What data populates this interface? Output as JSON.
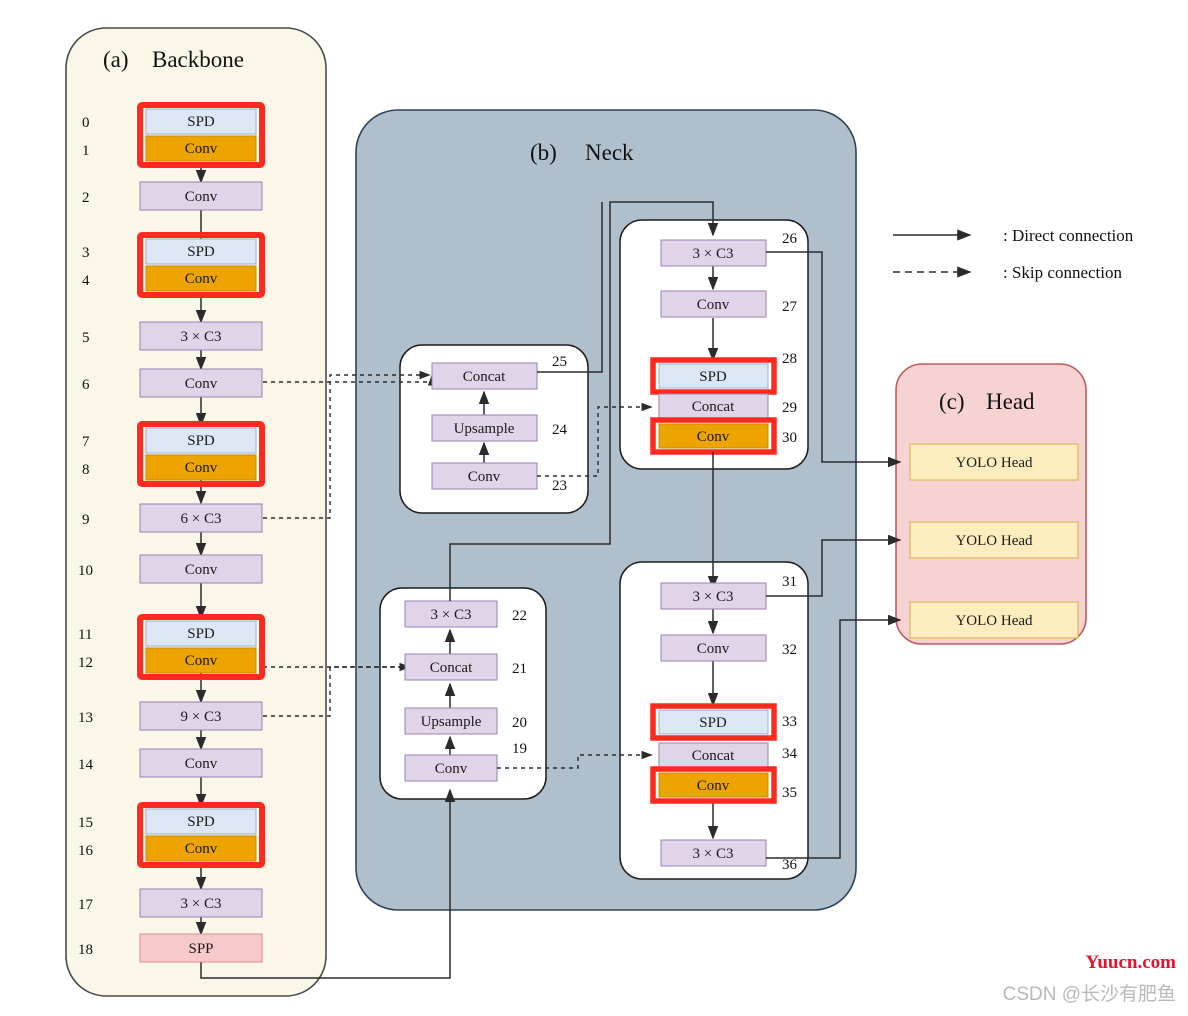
{
  "panels": {
    "backbone": {
      "tag": "(a)",
      "title": "Backbone",
      "fill": "#faf7e8",
      "border": "#4a4a4a"
    },
    "neck": {
      "tag": "(b)",
      "title": "Neck",
      "fill": "#b0bfcc",
      "border": "#2f4356"
    },
    "head": {
      "tag": "(c)",
      "title": "Head",
      "fill": "#f7d2d2",
      "border": "#c05a5a"
    }
  },
  "colors": {
    "spd": "#dce6f5",
    "conv_highlight": "#eda400",
    "conv_normal": "#e0d4e8",
    "spp": "#f6caca",
    "yolo_head": "#fdedbe",
    "highlight_border": "#ff2a1f",
    "block_border": "#9a7fb0",
    "arrow": "#2b2b2b"
  },
  "backbone_nodes": [
    {
      "id": "0",
      "label": "SPD",
      "type": "spd",
      "highlight": true
    },
    {
      "id": "1",
      "label": "Conv",
      "type": "conv_hl",
      "highlight": true
    },
    {
      "id": "2",
      "label": "Conv",
      "type": "conv",
      "highlight": false
    },
    {
      "id": "3",
      "label": "SPD",
      "type": "spd",
      "highlight": true
    },
    {
      "id": "4",
      "label": "Conv",
      "type": "conv_hl",
      "highlight": true
    },
    {
      "id": "5",
      "label": "3 × C3",
      "type": "conv",
      "highlight": false
    },
    {
      "id": "6",
      "label": "Conv",
      "type": "conv",
      "highlight": false
    },
    {
      "id": "7",
      "label": "SPD",
      "type": "spd",
      "highlight": true
    },
    {
      "id": "8",
      "label": "Conv",
      "type": "conv_hl",
      "highlight": true
    },
    {
      "id": "9",
      "label": "6 × C3",
      "type": "conv",
      "highlight": false
    },
    {
      "id": "10",
      "label": "Conv",
      "type": "conv",
      "highlight": false
    },
    {
      "id": "11",
      "label": "SPD",
      "type": "spd",
      "highlight": true
    },
    {
      "id": "12",
      "label": "Conv",
      "type": "conv_hl",
      "highlight": true
    },
    {
      "id": "13",
      "label": "9 × C3",
      "type": "conv",
      "highlight": false
    },
    {
      "id": "14",
      "label": "Conv",
      "type": "conv",
      "highlight": false
    },
    {
      "id": "15",
      "label": "SPD",
      "type": "spd",
      "highlight": true
    },
    {
      "id": "16",
      "label": "Conv",
      "type": "conv_hl",
      "highlight": true
    },
    {
      "id": "17",
      "label": "3 × C3",
      "type": "conv",
      "highlight": false
    },
    {
      "id": "18",
      "label": "SPP",
      "type": "spp",
      "highlight": false
    }
  ],
  "neck_group_lower_left": [
    {
      "id": "19",
      "label": "Conv",
      "type": "conv"
    },
    {
      "id": "20",
      "label": "Upsample",
      "type": "conv"
    },
    {
      "id": "21",
      "label": "Concat",
      "type": "conv"
    },
    {
      "id": "22",
      "label": "3 × C3",
      "type": "conv"
    }
  ],
  "neck_group_upper_left": [
    {
      "id": "23",
      "label": "Conv",
      "type": "conv"
    },
    {
      "id": "24",
      "label": "Upsample",
      "type": "conv"
    },
    {
      "id": "25",
      "label": "Concat",
      "type": "conv"
    }
  ],
  "neck_group_upper_right": [
    {
      "id": "26",
      "label": "3 × C3",
      "type": "conv",
      "highlight": false
    },
    {
      "id": "27",
      "label": "Conv",
      "type": "conv",
      "highlight": false
    },
    {
      "id": "28",
      "label": "SPD",
      "type": "spd",
      "highlight": true
    },
    {
      "id": "29",
      "label": "Concat",
      "type": "conv",
      "highlight": false
    },
    {
      "id": "30",
      "label": "Conv",
      "type": "conv_hl",
      "highlight": true
    }
  ],
  "neck_group_lower_right": [
    {
      "id": "31",
      "label": "3 × C3",
      "type": "conv",
      "highlight": false
    },
    {
      "id": "32",
      "label": "Conv",
      "type": "conv",
      "highlight": false
    },
    {
      "id": "33",
      "label": "SPD",
      "type": "spd",
      "highlight": true
    },
    {
      "id": "34",
      "label": "Concat",
      "type": "conv",
      "highlight": false
    },
    {
      "id": "35",
      "label": "Conv",
      "type": "conv_hl",
      "highlight": true
    },
    {
      "id": "36",
      "label": "3 × C3",
      "type": "conv",
      "highlight": false
    }
  ],
  "head_blocks": [
    {
      "label": "YOLO Head"
    },
    {
      "label": "YOLO Head"
    },
    {
      "label": "YOLO Head"
    }
  ],
  "legend": [
    {
      "style": "solid",
      "text": ": Direct connection"
    },
    {
      "style": "dashed",
      "text": ": Skip connection"
    }
  ],
  "watermarks": {
    "site": "Yuucn.com",
    "csdn": "CSDN @长沙有肥鱼"
  }
}
